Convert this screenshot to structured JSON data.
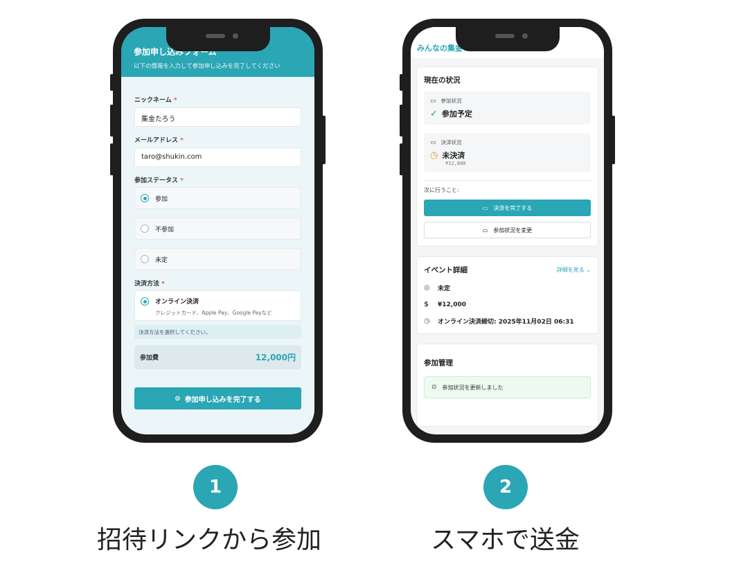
{
  "phone1": {
    "header_title": "参加申し込みフォーム",
    "header_subtitle": "以下の情報を入力して参加申し込みを完了してください",
    "nickname_label": "ニックネーム",
    "nickname_value": "集金たろう",
    "email_label": "メールアドレス",
    "email_value": "taro@shukin.com",
    "required_mark": "*",
    "status_label": "参加ステータス",
    "status_options": [
      "参加",
      "不参加",
      "未定"
    ],
    "status_selected": "参加",
    "payment_label": "決済方法",
    "payment_option_title": "オンライン決済",
    "payment_option_desc": "クレジットカード、Apple Pay、Google Payなど",
    "payment_note": "決済方法を選択してください。",
    "fee_label": "参加費",
    "fee_value": "12,000円",
    "submit_label": "参加申し込みを完了する"
  },
  "phone2": {
    "brand": "みんなの集金",
    "status_card_title": "現在の状況",
    "participation_label": "参加状況",
    "participation_value": "参加予定",
    "payment_label": "決済状況",
    "payment_value": "未決済",
    "payment_amount": "¥12,000",
    "next_label": "次に行うこと:",
    "pay_button": "決済を完了する",
    "change_button": "参加状況を変更",
    "event_title": "イベント詳細",
    "event_link": "詳細を見る",
    "event_place": "未定",
    "event_fee": "¥12,000",
    "event_deadline": "オンライン決済締切: 2025年11月02日 06:31",
    "manage_title": "参加管理",
    "success_message": "参加状況を更新しました"
  },
  "steps": [
    {
      "number": "1",
      "caption": "招待リンクから参加"
    },
    {
      "number": "2",
      "caption": "スマホで送金"
    }
  ],
  "colors": {
    "accent": "#2aa6b5",
    "pending": "#e8a317",
    "success": "#27a84a"
  }
}
